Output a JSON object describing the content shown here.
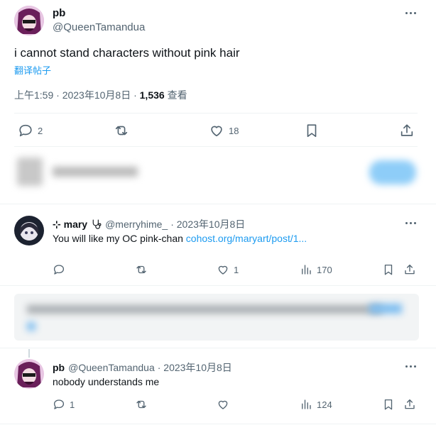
{
  "main_tweet": {
    "display_name": "pb",
    "handle": "@QueenTamandua",
    "text": "i cannot stand characters without pink hair",
    "translate_label": "翻译帖子",
    "timestamp": "上午1:59 · 2023年10月8日 · ",
    "views_count": "1,536",
    "views_label": " 查看",
    "replies": "2",
    "likes": "18"
  },
  "reply_1": {
    "display_name": "⊹ mary",
    "handle": "@merryhime_",
    "date": "· 2023年10月8日",
    "text": "You will like my OC pink-chan ",
    "link_text": "cohost.org/maryart/post/1...",
    "likes": "1",
    "views": "170"
  },
  "reply_2": {
    "display_name": "pb",
    "handle": "@QueenTamandua",
    "date": "· 2023年10月8日",
    "text": "nobody understands me",
    "replies": "1",
    "views": "124"
  },
  "icons": [
    "more-icon",
    "reply-icon",
    "retweet-icon",
    "like-icon",
    "bookmark-icon",
    "share-icon",
    "views-icon",
    "stethoscope-icon"
  ],
  "colors": {
    "link_blue": "#1d9bf0",
    "muted": "#536471",
    "text": "#0f1419",
    "divider": "#eff3f4"
  }
}
